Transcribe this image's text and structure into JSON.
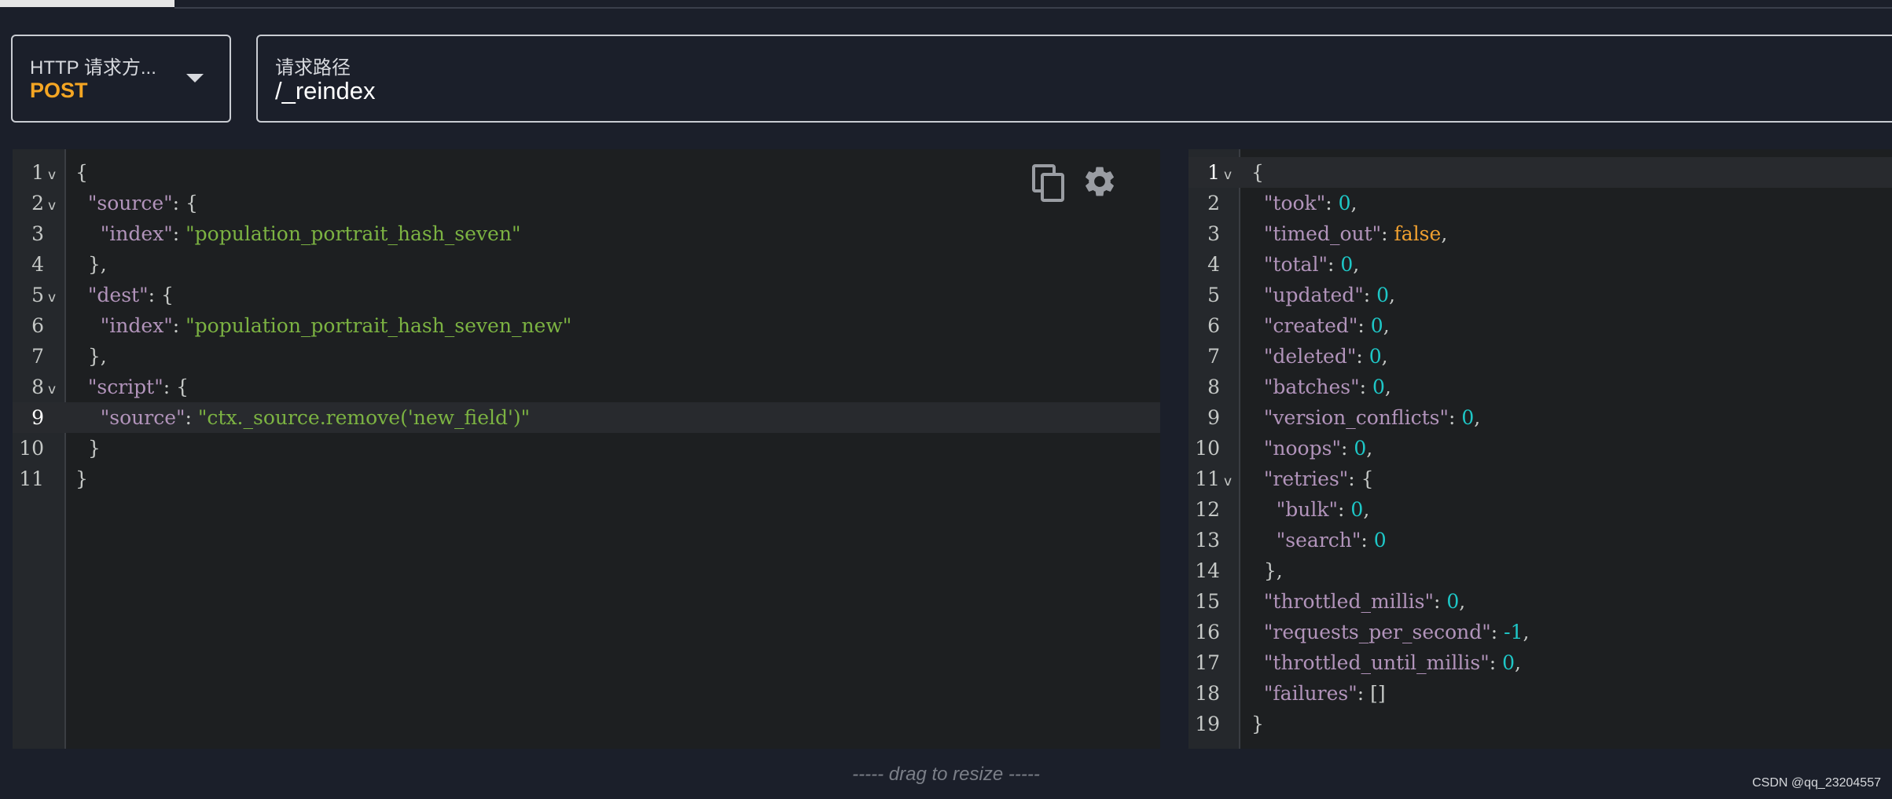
{
  "request": {
    "method_label": "HTTP 请求方...",
    "method_value": "POST",
    "path_label": "请求路径",
    "path_value": "/_reindex"
  },
  "request_body": {
    "lines": [
      {
        "n": "1",
        "fold": true,
        "active": false,
        "tokens": [
          [
            "punc",
            "{"
          ]
        ]
      },
      {
        "n": "2",
        "fold": true,
        "active": false,
        "tokens": [
          [
            "punc",
            "  "
          ],
          [
            "key",
            "\"source\""
          ],
          [
            "punc",
            ": {"
          ]
        ]
      },
      {
        "n": "3",
        "fold": false,
        "active": false,
        "tokens": [
          [
            "punc",
            "    "
          ],
          [
            "key",
            "\"index\""
          ],
          [
            "punc",
            ": "
          ],
          [
            "str",
            "\"population_portrait_hash_seven\""
          ]
        ]
      },
      {
        "n": "4",
        "fold": false,
        "active": false,
        "tokens": [
          [
            "punc",
            "  },"
          ]
        ]
      },
      {
        "n": "5",
        "fold": true,
        "active": false,
        "tokens": [
          [
            "punc",
            "  "
          ],
          [
            "key",
            "\"dest\""
          ],
          [
            "punc",
            ": {"
          ]
        ]
      },
      {
        "n": "6",
        "fold": false,
        "active": false,
        "tokens": [
          [
            "punc",
            "    "
          ],
          [
            "key",
            "\"index\""
          ],
          [
            "punc",
            ": "
          ],
          [
            "str",
            "\"population_portrait_hash_seven_new\""
          ]
        ]
      },
      {
        "n": "7",
        "fold": false,
        "active": false,
        "tokens": [
          [
            "punc",
            "  },"
          ]
        ]
      },
      {
        "n": "8",
        "fold": true,
        "active": false,
        "tokens": [
          [
            "punc",
            "  "
          ],
          [
            "key",
            "\"script\""
          ],
          [
            "punc",
            ": {"
          ]
        ]
      },
      {
        "n": "9",
        "fold": false,
        "active": true,
        "tokens": [
          [
            "punc",
            "    "
          ],
          [
            "key",
            "\"source\""
          ],
          [
            "punc",
            ": "
          ],
          [
            "str",
            "\"ctx._source.remove('new_field')\""
          ]
        ]
      },
      {
        "n": "10",
        "fold": false,
        "active": false,
        "tokens": [
          [
            "punc",
            "  }"
          ]
        ]
      },
      {
        "n": "11",
        "fold": false,
        "active": false,
        "tokens": [
          [
            "punc",
            "}"
          ]
        ]
      }
    ]
  },
  "response_body": {
    "lines": [
      {
        "n": "1",
        "fold": true,
        "active": true,
        "tokens": [
          [
            "punc",
            "{"
          ]
        ]
      },
      {
        "n": "2",
        "fold": false,
        "active": false,
        "tokens": [
          [
            "punc",
            "  "
          ],
          [
            "key",
            "\"took\""
          ],
          [
            "punc",
            ": "
          ],
          [
            "num",
            "0"
          ],
          [
            "punc",
            ","
          ]
        ]
      },
      {
        "n": "3",
        "fold": false,
        "active": false,
        "tokens": [
          [
            "punc",
            "  "
          ],
          [
            "key",
            "\"timed_out\""
          ],
          [
            "punc",
            ": "
          ],
          [
            "bool",
            "false"
          ],
          [
            "punc",
            ","
          ]
        ]
      },
      {
        "n": "4",
        "fold": false,
        "active": false,
        "tokens": [
          [
            "punc",
            "  "
          ],
          [
            "key",
            "\"total\""
          ],
          [
            "punc",
            ": "
          ],
          [
            "num",
            "0"
          ],
          [
            "punc",
            ","
          ]
        ]
      },
      {
        "n": "5",
        "fold": false,
        "active": false,
        "tokens": [
          [
            "punc",
            "  "
          ],
          [
            "key",
            "\"updated\""
          ],
          [
            "punc",
            ": "
          ],
          [
            "num",
            "0"
          ],
          [
            "punc",
            ","
          ]
        ]
      },
      {
        "n": "6",
        "fold": false,
        "active": false,
        "tokens": [
          [
            "punc",
            "  "
          ],
          [
            "key",
            "\"created\""
          ],
          [
            "punc",
            ": "
          ],
          [
            "num",
            "0"
          ],
          [
            "punc",
            ","
          ]
        ]
      },
      {
        "n": "7",
        "fold": false,
        "active": false,
        "tokens": [
          [
            "punc",
            "  "
          ],
          [
            "key",
            "\"deleted\""
          ],
          [
            "punc",
            ": "
          ],
          [
            "num",
            "0"
          ],
          [
            "punc",
            ","
          ]
        ]
      },
      {
        "n": "8",
        "fold": false,
        "active": false,
        "tokens": [
          [
            "punc",
            "  "
          ],
          [
            "key",
            "\"batches\""
          ],
          [
            "punc",
            ": "
          ],
          [
            "num",
            "0"
          ],
          [
            "punc",
            ","
          ]
        ]
      },
      {
        "n": "9",
        "fold": false,
        "active": false,
        "tokens": [
          [
            "punc",
            "  "
          ],
          [
            "key",
            "\"version_conflicts\""
          ],
          [
            "punc",
            ": "
          ],
          [
            "num",
            "0"
          ],
          [
            "punc",
            ","
          ]
        ]
      },
      {
        "n": "10",
        "fold": false,
        "active": false,
        "tokens": [
          [
            "punc",
            "  "
          ],
          [
            "key",
            "\"noops\""
          ],
          [
            "punc",
            ": "
          ],
          [
            "num",
            "0"
          ],
          [
            "punc",
            ","
          ]
        ]
      },
      {
        "n": "11",
        "fold": true,
        "active": false,
        "tokens": [
          [
            "punc",
            "  "
          ],
          [
            "key",
            "\"retries\""
          ],
          [
            "punc",
            ": {"
          ]
        ]
      },
      {
        "n": "12",
        "fold": false,
        "active": false,
        "tokens": [
          [
            "punc",
            "    "
          ],
          [
            "key",
            "\"bulk\""
          ],
          [
            "punc",
            ": "
          ],
          [
            "num",
            "0"
          ],
          [
            "punc",
            ","
          ]
        ]
      },
      {
        "n": "13",
        "fold": false,
        "active": false,
        "tokens": [
          [
            "punc",
            "    "
          ],
          [
            "key",
            "\"search\""
          ],
          [
            "punc",
            ": "
          ],
          [
            "num",
            "0"
          ]
        ]
      },
      {
        "n": "14",
        "fold": false,
        "active": false,
        "tokens": [
          [
            "punc",
            "  },"
          ]
        ]
      },
      {
        "n": "15",
        "fold": false,
        "active": false,
        "tokens": [
          [
            "punc",
            "  "
          ],
          [
            "key",
            "\"throttled_millis\""
          ],
          [
            "punc",
            ": "
          ],
          [
            "num",
            "0"
          ],
          [
            "punc",
            ","
          ]
        ]
      },
      {
        "n": "16",
        "fold": false,
        "active": false,
        "tokens": [
          [
            "punc",
            "  "
          ],
          [
            "key",
            "\"requests_per_second\""
          ],
          [
            "punc",
            ": "
          ],
          [
            "num",
            "-1"
          ],
          [
            "punc",
            ","
          ]
        ]
      },
      {
        "n": "17",
        "fold": false,
        "active": false,
        "tokens": [
          [
            "punc",
            "  "
          ],
          [
            "key",
            "\"throttled_until_millis\""
          ],
          [
            "punc",
            ": "
          ],
          [
            "num",
            "0"
          ],
          [
            "punc",
            ","
          ]
        ]
      },
      {
        "n": "18",
        "fold": false,
        "active": false,
        "tokens": [
          [
            "punc",
            "  "
          ],
          [
            "key",
            "\"failures\""
          ],
          [
            "punc",
            ": []"
          ]
        ]
      },
      {
        "n": "19",
        "fold": false,
        "active": false,
        "tokens": [
          [
            "punc",
            "}"
          ]
        ]
      }
    ]
  },
  "toolbar": {
    "copy_icon": "copy-icon",
    "settings_icon": "gear-icon"
  },
  "footer": {
    "resize_label": "----- drag to resize -----",
    "watermark": "CSDN @qq_23204557"
  },
  "colors": {
    "background": "#1b1f2a",
    "editor_bg": "#1d1f21",
    "method_accent": "#f5a623",
    "json_key": "#b294bb",
    "json_string": "#7cb342",
    "json_number": "#1ec7c7",
    "json_boolean": "#f0a030"
  }
}
